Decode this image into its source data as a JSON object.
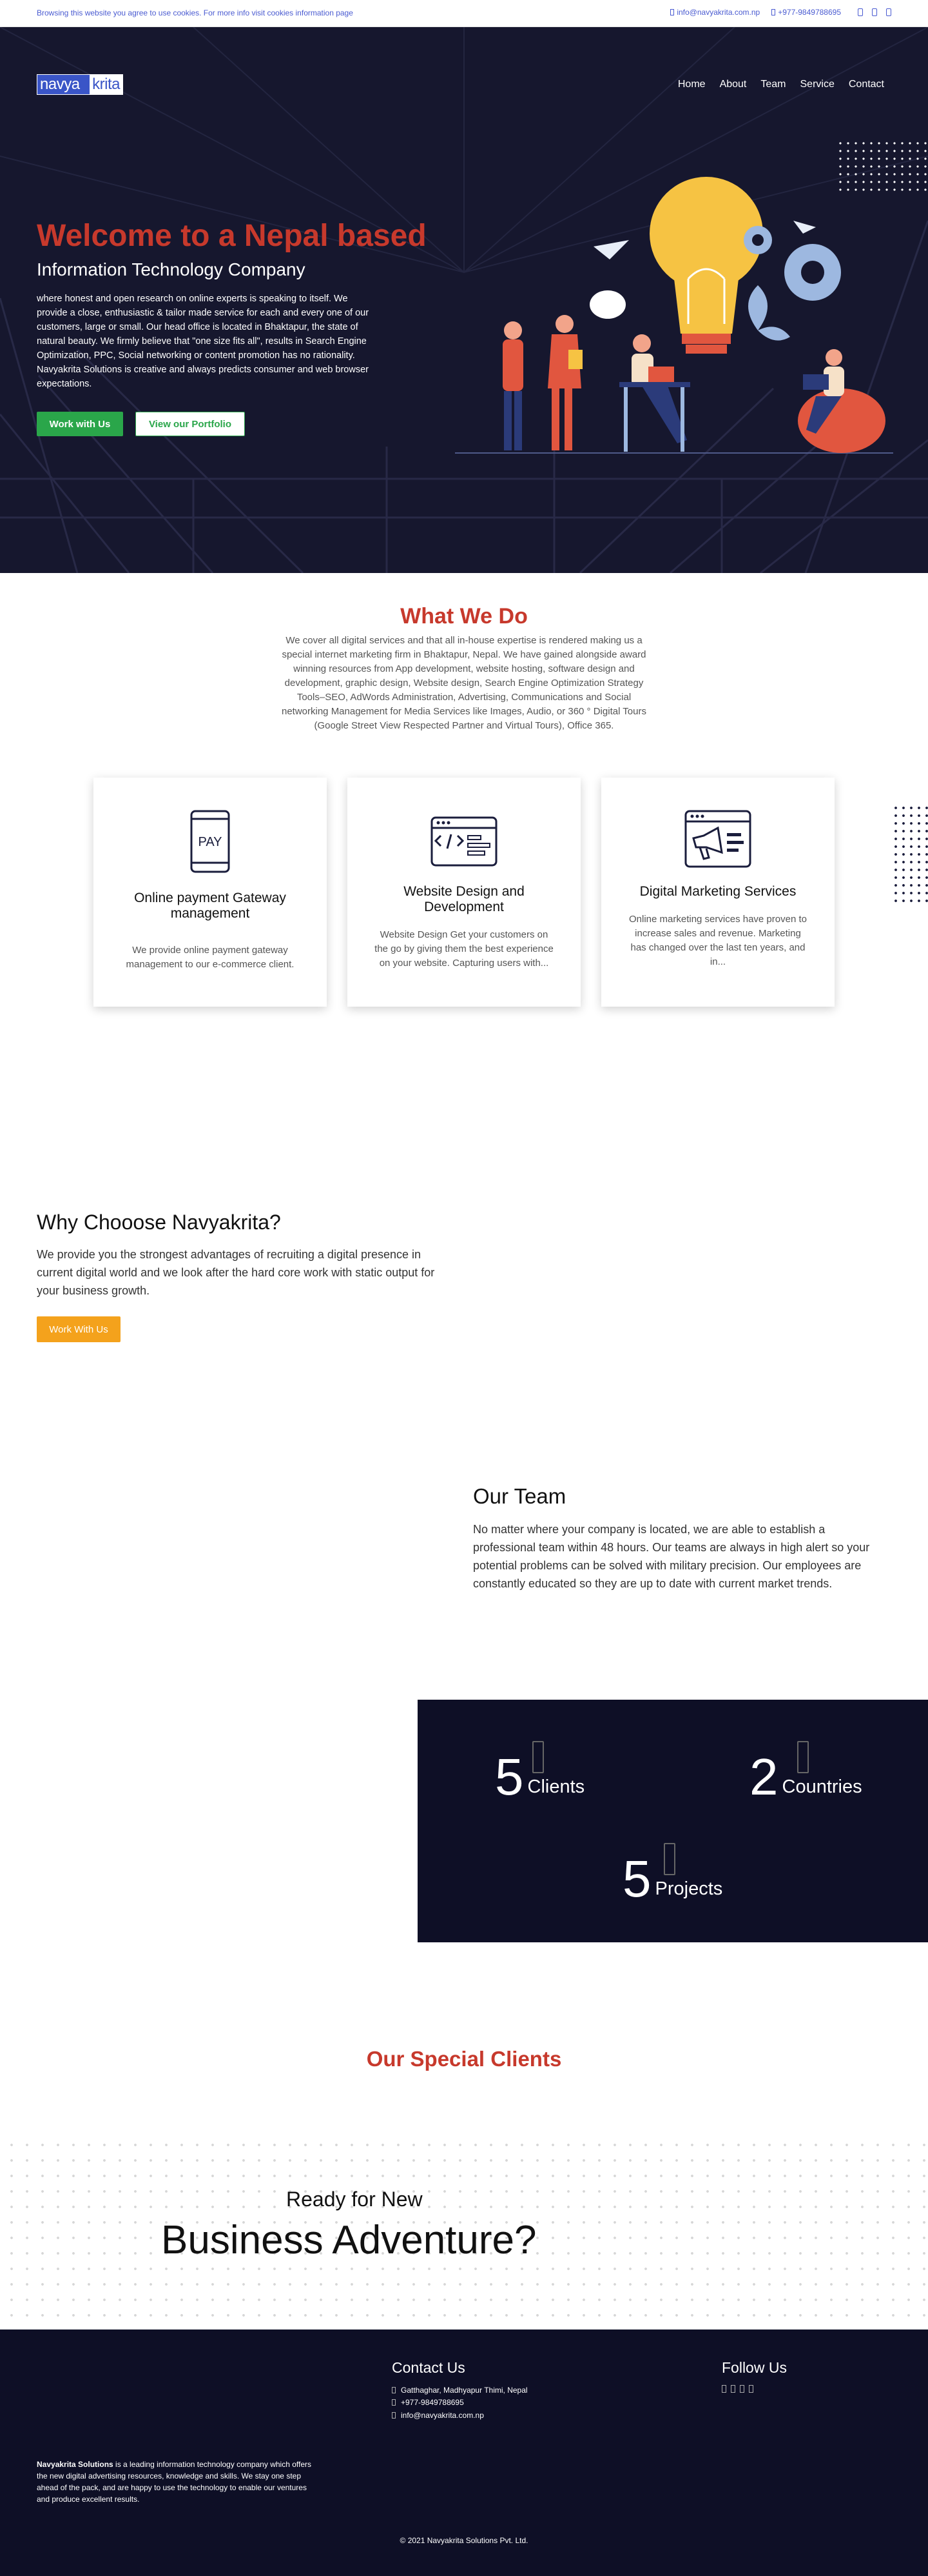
{
  "topbar": {
    "cookie_text": "Browsing this website you agree to use cookies. For more info visit cookies information page",
    "email": "info@navyakrita.com.np",
    "phone": "+977-9849788695"
  },
  "header": {
    "logo_text_left": "navya",
    "logo_text_right": "krita",
    "nav": [
      "Home",
      "About",
      "Team",
      "Service",
      "Contact"
    ]
  },
  "hero": {
    "title": "Welcome to a Nepal based",
    "subtitle": "Information Technology Company",
    "description": "where honest and open research on online experts is speaking to itself. We provide a close, enthusiastic & tailor made service for each and every one of our customers, large or small. Our head office is located in Bhaktapur, the state of natural beauty. We firmly believe that \"one size fits all\", results in Search Engine Optimization, PPC, Social networking or content promotion has no rationality. Navyakrita Solutions is creative and always predicts consumer and web browser expectations.",
    "button_work": "Work with Us",
    "button_portfolio": "View our Portfolio",
    "colors": {
      "background": "#16172e",
      "title": "#c7392c",
      "green": "#2aa64a"
    }
  },
  "what_we_do": {
    "title": "What We Do",
    "description": "We cover all digital services and that all in-house expertise is rendered making us a special internet marketing firm in Bhaktapur, Nepal. We have gained alongside award winning resources from App development, website hosting, software design and development, graphic design, Website design, Search Engine Optimization Strategy Tools–SEO, AdWords Administration, Advertising, Communications and Social networking Management for Media Services like Images, Audio, or 360 ° Digital Tours (Google Street View Respected Partner and Virtual Tours), Office 365.",
    "cards": [
      {
        "icon": "payment-pay-icon",
        "icon_text": "PAY",
        "title": "Online payment Gateway management",
        "desc": "We provide online payment gateway management to our e-commerce client."
      },
      {
        "icon": "code-window-icon",
        "title": "Website Design and Development",
        "desc": "Website Design Get your customers on the go by giving them the best experience on your website. Capturing users with..."
      },
      {
        "icon": "megaphone-icon",
        "title": "Digital Marketing Services",
        "desc": "Online marketing services have proven to increase sales and revenue. Marketing has changed over the last ten years, and in..."
      }
    ]
  },
  "why": {
    "title": "Why Chooose Navyakrita?",
    "description": "We provide you the strongest advantages of recruiting a digital presence in current digital world and we look after the hard core work with static output for your business growth.",
    "button": "Work With Us"
  },
  "team": {
    "title": "Our Team",
    "description": "No matter where your company is located, we are able to establish a professional team within 48 hours. Our teams are always in high alert so your potential problems can be solved with military precision. Our employees are constantly educated so they are up to date with current market trends."
  },
  "stats": [
    {
      "value": "5",
      "label": "Clients"
    },
    {
      "value": "2",
      "label": "Countries"
    },
    {
      "value": "5",
      "label": "Projects"
    }
  ],
  "clients": {
    "title": "Our Special Clients"
  },
  "ready": {
    "small": "Ready for New",
    "big": "Business Adventure?"
  },
  "footer": {
    "contact_title": "Contact Us",
    "address": "Gatthaghar, Madhyapur Thimi, Nepal",
    "phone": "+977-9849788695",
    "email": "info@navyakrita.com.np",
    "follow_title": "Follow Us",
    "social_icons": [
      "facebook-icon",
      "twitter-icon",
      "linkedin-icon",
      "instagram-icon"
    ],
    "about_bold": "Navyakrita Solutions",
    "about_text": " is a leading information technology company which offers the new digital advertising resources, knowledge and skills. We stay one step ahead of the pack, and are happy to use the technology to enable our ventures and produce excellent results.",
    "copyright": "© 2021 Navyakrita Solutions Pvt. Ltd."
  }
}
